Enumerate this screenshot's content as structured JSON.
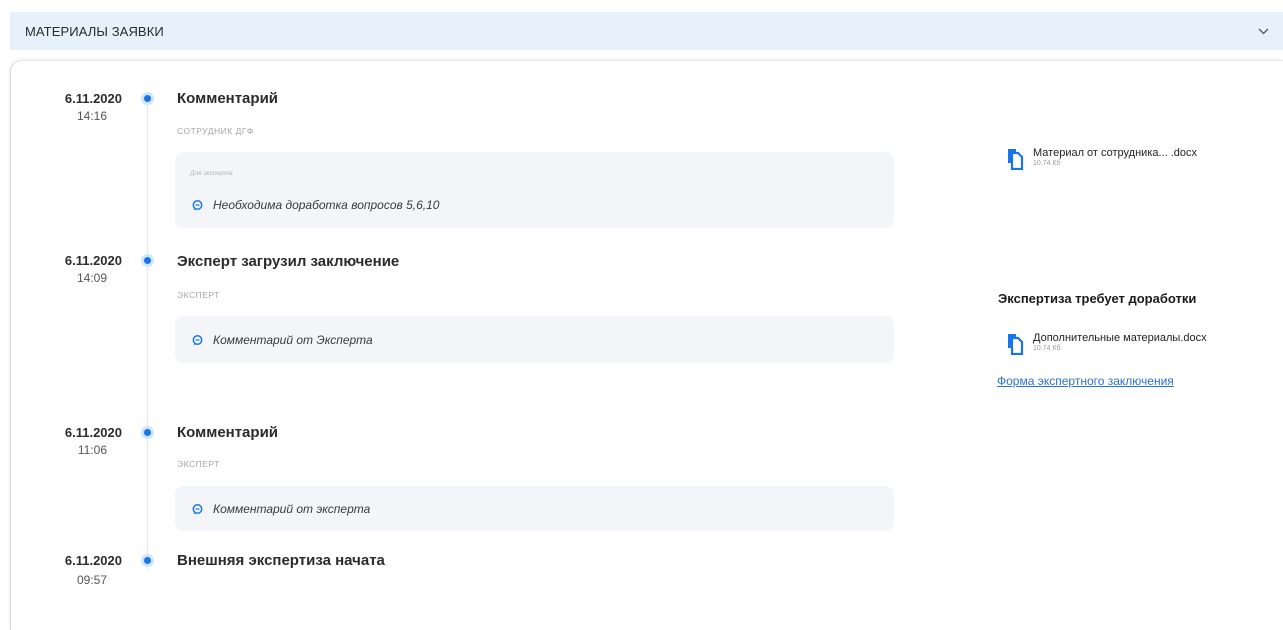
{
  "header": {
    "title": "МАТЕРИАЛЫ ЗАЯВКИ",
    "toggle_icon": "chevron-down-icon"
  },
  "timeline": [
    {
      "date": "6.11.2020",
      "time": "14:16",
      "title": "Комментарий",
      "role": "СОТРУДНИК ДГФ",
      "comment_hint": "Для эксперта",
      "comment": "Необходима доработка вопросов 5,6,10"
    },
    {
      "date": "6.11.2020",
      "time": "14:09",
      "title": "Эксперт загрузил заключение",
      "role": "ЭКСПЕРТ",
      "comment": "Комментарий от Эксперта"
    },
    {
      "date": "6.11.2020",
      "time": "11:06",
      "title": "Комментарий",
      "role": "ЭКСПЕРТ",
      "comment": "Комментарий от эксперта"
    },
    {
      "date": "6.11.2020",
      "time": "09:57",
      "title": "Внешняя экспертиза начата"
    }
  ],
  "files": [
    {
      "name": "Материал от сотрудника... .docx",
      "size": "10.74 Кб",
      "icon": "document-copy-icon"
    },
    {
      "name": "Дополнительные материалы.docx",
      "size": "10.74 Кб",
      "icon": "document-copy-icon"
    }
  ],
  "expertise": {
    "title": "Экспертиза требует доработки",
    "form_link": "Форма экспертного заключения"
  },
  "colors": {
    "accent": "#1976e8",
    "header_bg": "#e7f1fb",
    "comment_bg": "#f4f5f9",
    "link": "#2a72d6"
  }
}
